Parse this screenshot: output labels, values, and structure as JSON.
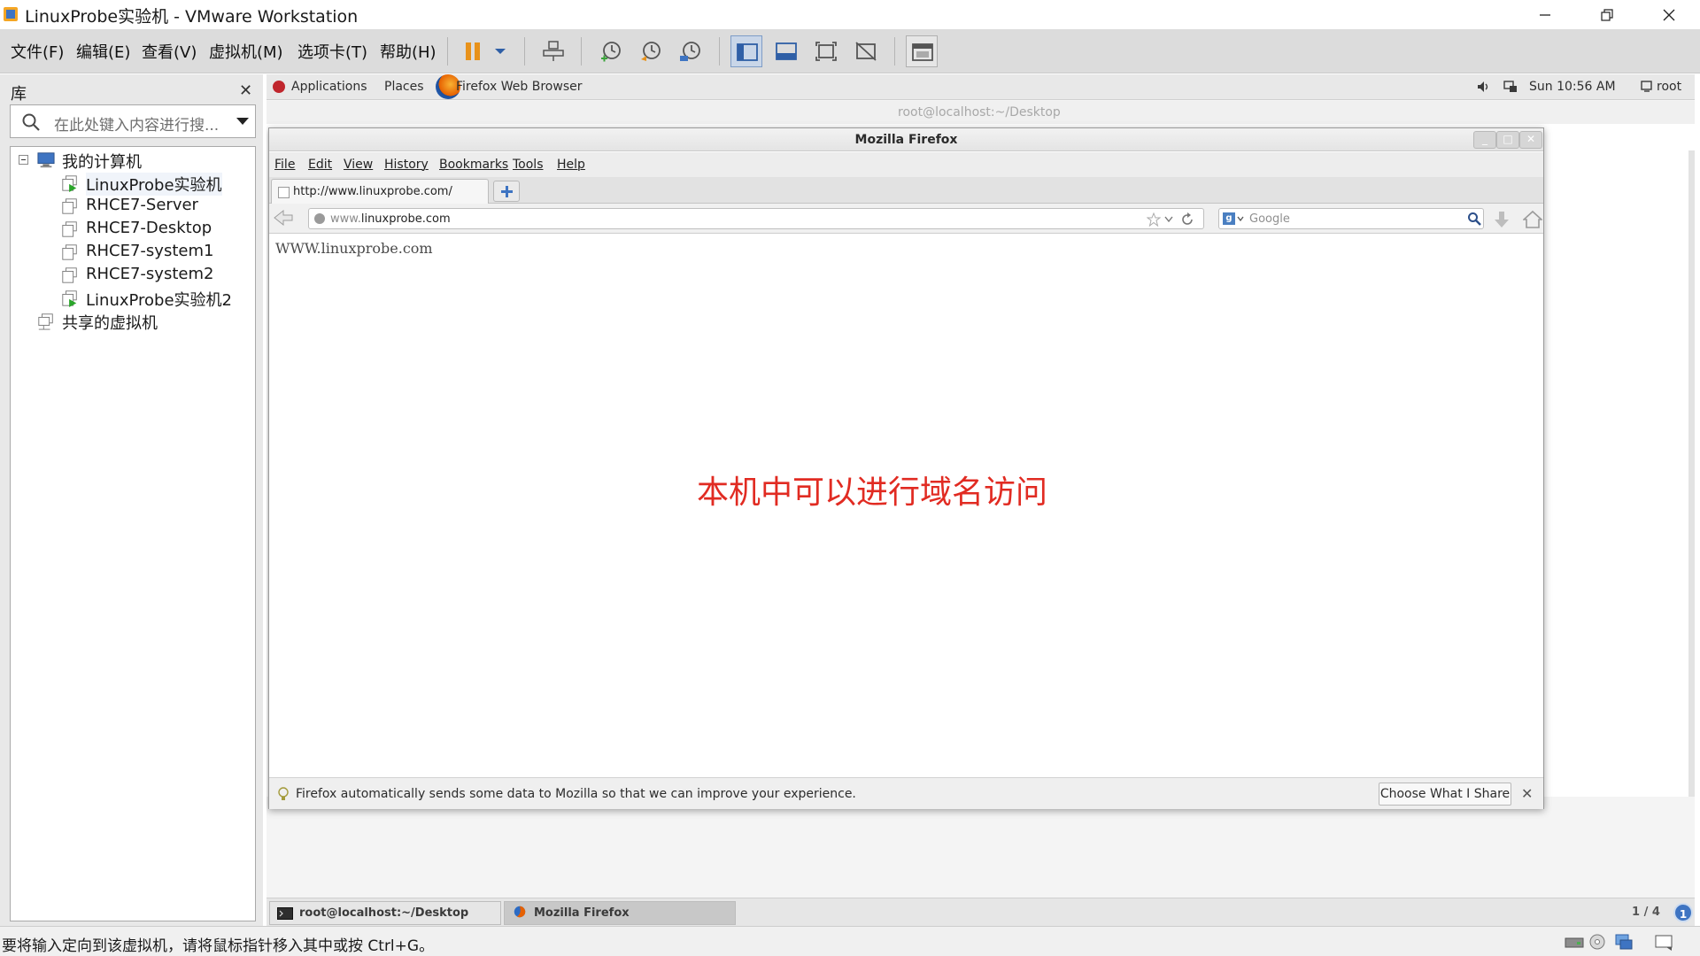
{
  "window": {
    "title": "LinuxProbe实验机 - VMware Workstation"
  },
  "menubar": {
    "items": [
      "文件(F)",
      "编辑(E)",
      "查看(V)",
      "虚拟机(M)",
      "选项卡(T)",
      "帮助(H)"
    ]
  },
  "library": {
    "title": "库",
    "search_placeholder": "在此处键入内容进行搜...",
    "tree": {
      "root": "我的计算机",
      "vms": [
        "LinuxProbe实验机",
        "RHCE7-Server",
        "RHCE7-Desktop",
        "RHCE7-system1",
        "RHCE7-system2",
        "LinuxProbe实验机2"
      ],
      "shared": "共享的虚拟机"
    }
  },
  "guest": {
    "top_panel": {
      "applications": "Applications",
      "places": "Places",
      "active_app": "Firefox Web Browser",
      "clock": "Sun 10:56 AM",
      "user": "root"
    },
    "terminal_title": "root@localhost:~/Desktop",
    "firefox": {
      "title": "Mozilla Firefox",
      "menu": [
        "File",
        "Edit",
        "View",
        "History",
        "Bookmarks",
        "Tools",
        "Help"
      ],
      "tab_label": "http://www.linuxprobe.com/",
      "url_prefix": "www.",
      "url_host": "linuxprobe.com",
      "search_placeholder": "Google",
      "page_text": "WWW.linuxprobe.com",
      "annotation": "本机中可以进行域名访问",
      "notification": "Firefox automatically sends some data to Mozilla so that we can improve your experience.",
      "notification_button": "Choose What I Share"
    },
    "taskbar": {
      "tasks": [
        "root@localhost:~/Desktop",
        "Mozilla Firefox"
      ],
      "pager": "1 / 4"
    }
  },
  "statusbar": {
    "text": "要将输入定向到该虚拟机，请将鼠标指针移入其中或按 Ctrl+G。"
  },
  "colors": {
    "annotation": "#e12b22",
    "toolbar_bg": "#dcdcdc",
    "accent": "#3e74c2"
  }
}
